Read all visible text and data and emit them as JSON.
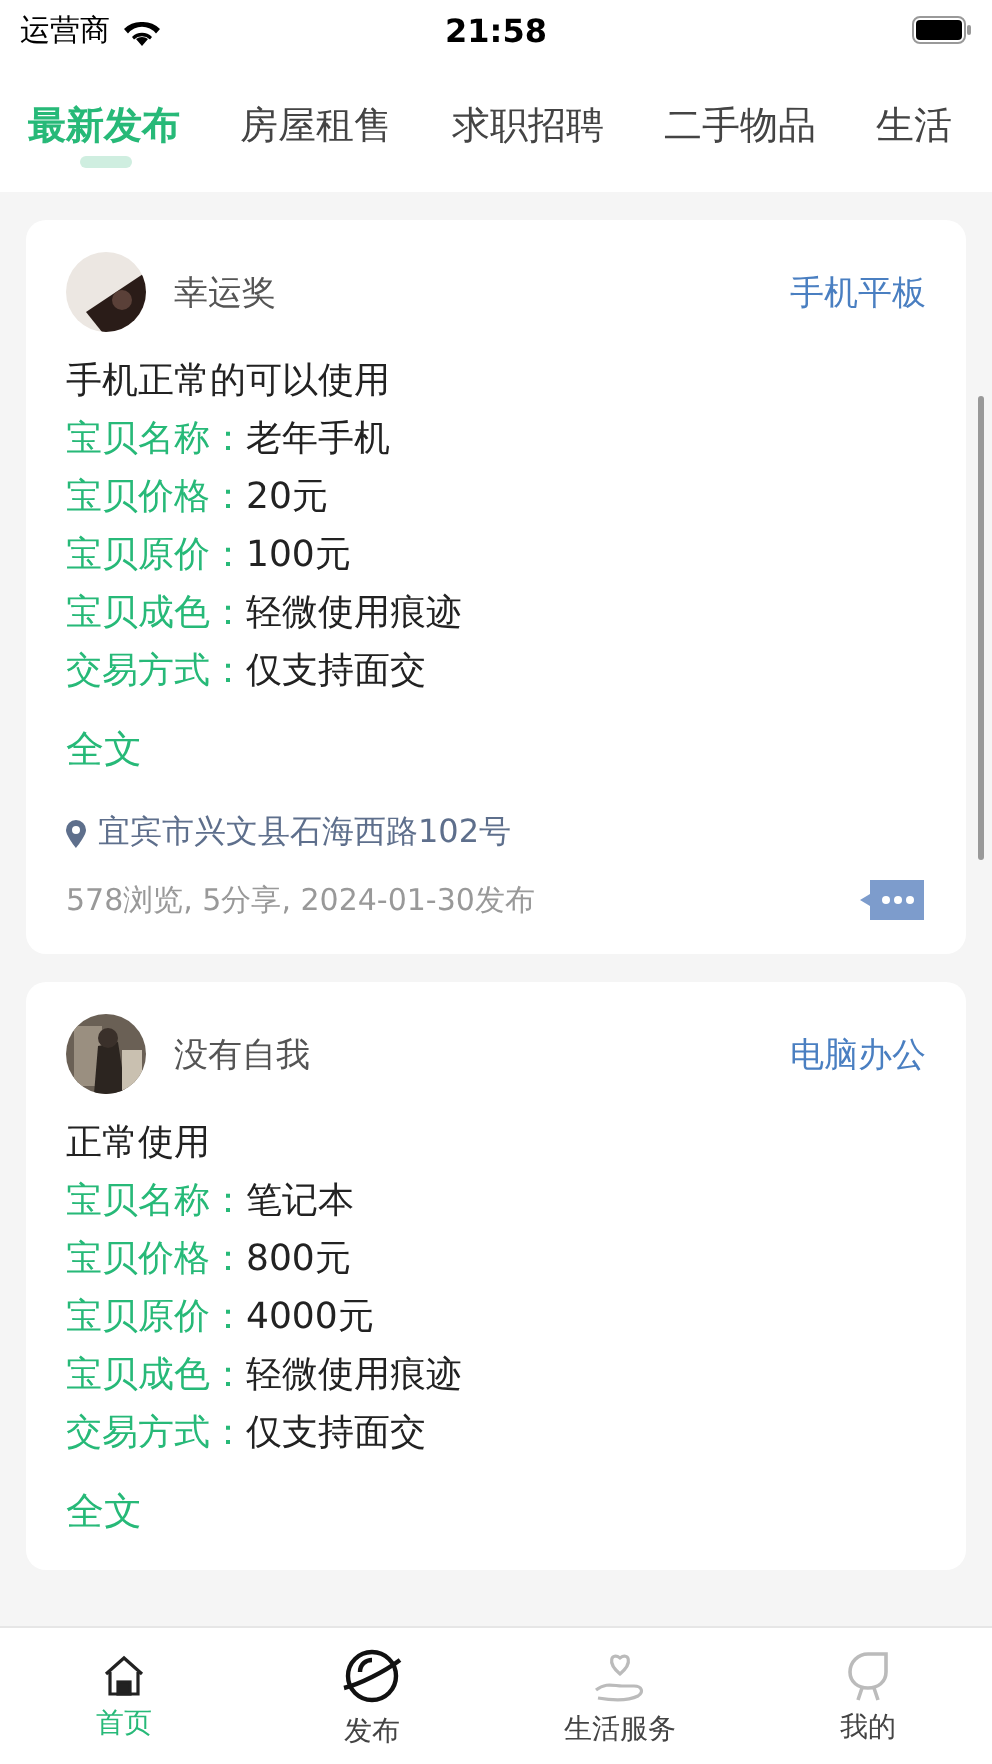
{
  "status_bar": {
    "carrier": "运营商",
    "time": "21:58"
  },
  "tabs": [
    {
      "label": "最新发布",
      "selected": true
    },
    {
      "label": "房屋租售",
      "selected": false
    },
    {
      "label": "求职招聘",
      "selected": false
    },
    {
      "label": "二手物品",
      "selected": false
    },
    {
      "label": "生活",
      "selected": false
    }
  ],
  "posts": [
    {
      "user": "幸运奖",
      "category": "手机平板",
      "description": "手机正常的可以使用",
      "fields": [
        {
          "label": "宝贝名称：",
          "value": "老年手机"
        },
        {
          "label": "宝贝价格：",
          "value": "20元"
        },
        {
          "label": "宝贝原价：",
          "value": "100元"
        },
        {
          "label": "宝贝成色：",
          "value": "轻微使用痕迹"
        },
        {
          "label": "交易方式：",
          "value": "仅支持面交"
        }
      ],
      "more": "全文",
      "location": "宜宾市兴文县石海西路102号",
      "stats": "578浏览, 5分享, 2024-01-30发布"
    },
    {
      "user": "没有自我",
      "category": "电脑办公",
      "description": "正常使用",
      "fields": [
        {
          "label": "宝贝名称：",
          "value": "笔记本"
        },
        {
          "label": "宝贝价格：",
          "value": "800元"
        },
        {
          "label": "宝贝原价：",
          "value": "4000元"
        },
        {
          "label": "宝贝成色：",
          "value": "轻微使用痕迹"
        },
        {
          "label": "交易方式：",
          "value": "仅支持面交"
        }
      ],
      "more": "全文"
    }
  ],
  "bottom_nav": [
    {
      "label": "首页",
      "kind": "home",
      "selected": true
    },
    {
      "label": "发布",
      "kind": "publish",
      "selected": false
    },
    {
      "label": "生活服务",
      "kind": "service",
      "selected": false
    },
    {
      "label": "我的",
      "kind": "mine",
      "selected": false
    }
  ]
}
